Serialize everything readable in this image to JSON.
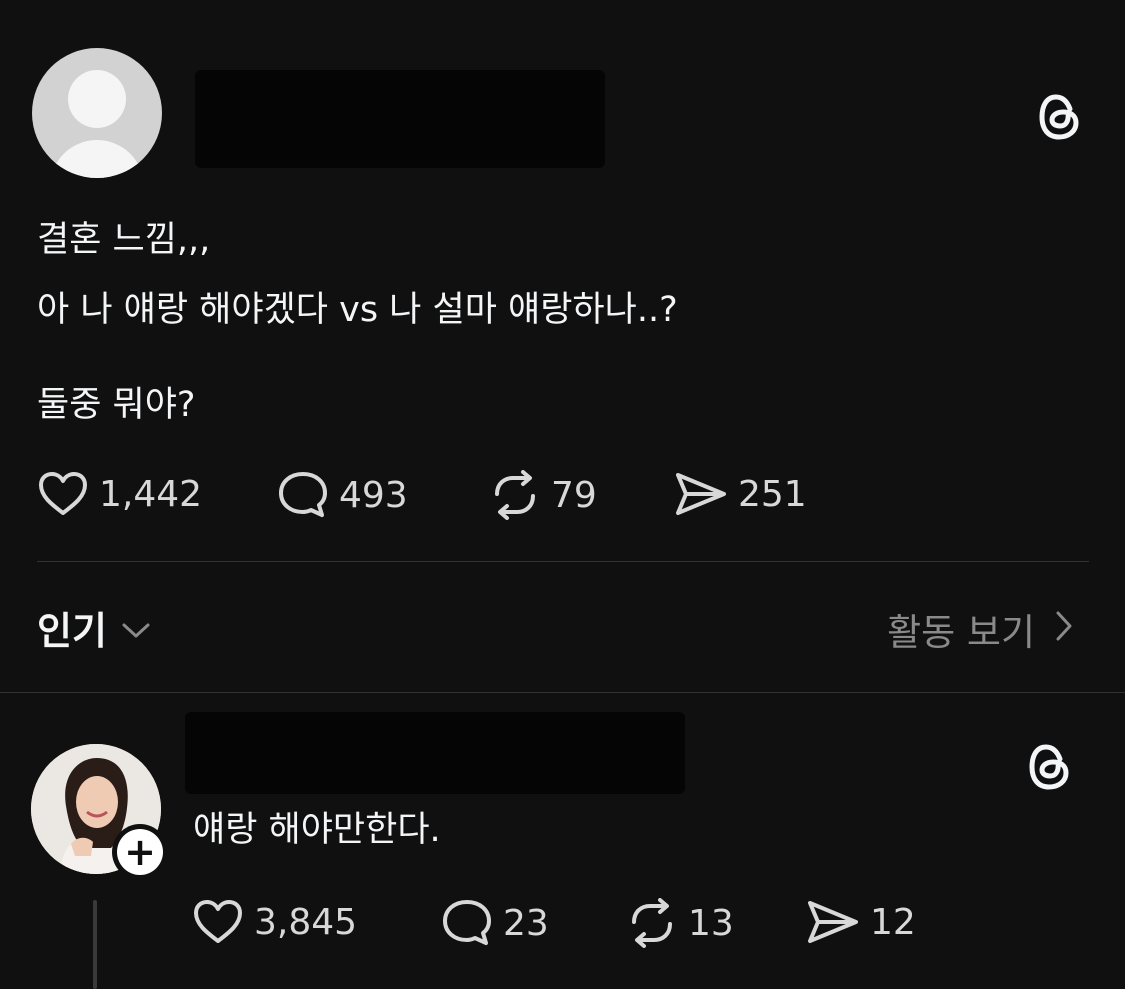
{
  "post": {
    "line1": "결혼 느낌,,,",
    "line2": "아 나 얘랑 해야겠다 vs 나 설마 얘랑하나..?",
    "line3": "둘중 뭐야?",
    "likes": "1,442",
    "replies": "493",
    "reposts": "79",
    "shares": "251"
  },
  "sort": {
    "label": "인기",
    "activity_label": "활동 보기"
  },
  "reply": {
    "text": "얘랑 해야만한다.",
    "likes": "3,845",
    "replies": "23",
    "reposts": "13",
    "shares": "12"
  },
  "icons": {
    "brand": "threads-icon",
    "like": "heart-icon",
    "reply": "comment-icon",
    "repost": "repost-icon",
    "share": "send-icon",
    "chevron_down": "chevron-down-icon",
    "chevron_right": "chevron-right-icon",
    "follow": "plus-icon"
  },
  "colors": {
    "background": "#101010",
    "text": "#f3f5f7",
    "muted": "#8a8a8a",
    "divider": "#323232"
  }
}
